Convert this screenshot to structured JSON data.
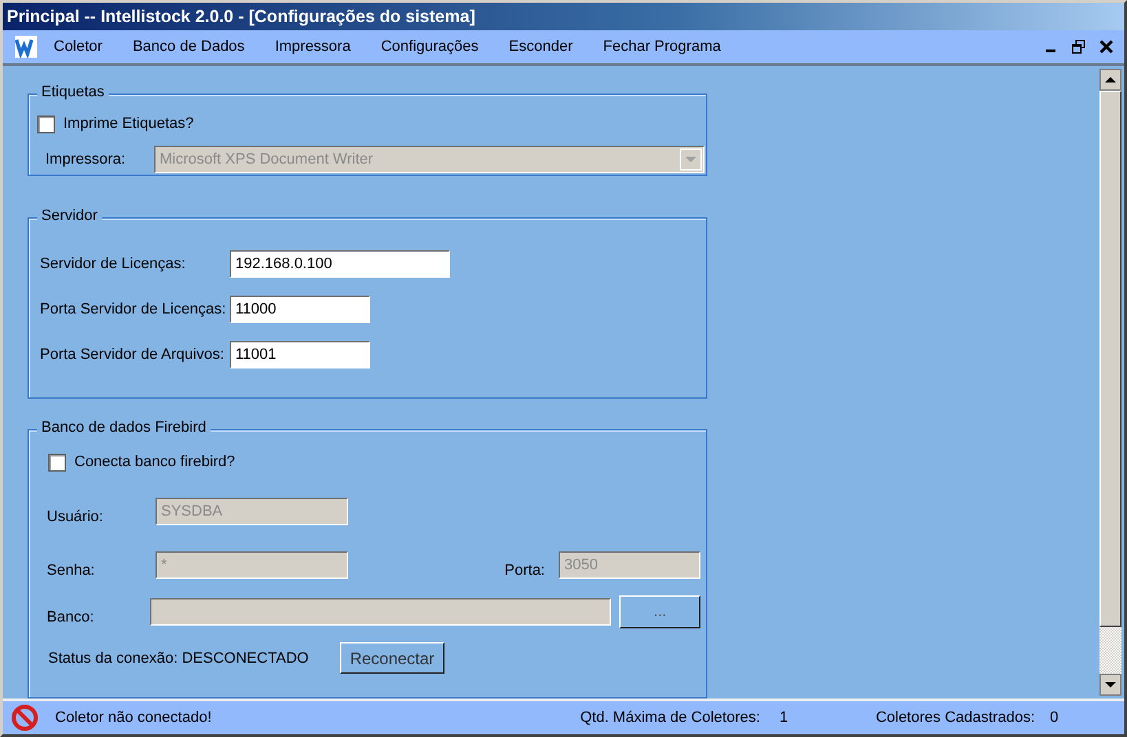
{
  "window": {
    "title": "Principal -- Intellistock 2.0.0 - [Configurações do sistema]"
  },
  "menu": {
    "items": [
      {
        "label": "Coletor"
      },
      {
        "label": "Banco de Dados"
      },
      {
        "label": "Impressora"
      },
      {
        "label": "Configurações"
      },
      {
        "label": "Esconder"
      },
      {
        "label": "Fechar Programa"
      }
    ]
  },
  "etiquetas": {
    "title": "Etiquetas",
    "checkbox": {
      "label": "Imprime Etiquetas?",
      "checked": false
    },
    "printer": {
      "label": "Impressora:",
      "value": "Microsoft XPS Document Writer",
      "disabled": true
    }
  },
  "servidor": {
    "title": "Servidor",
    "fields": [
      {
        "label": "Servidor de Licenças:",
        "value": "192.168.0.100",
        "disabled": false
      },
      {
        "label": "Porta Servidor de Licenças:",
        "value": "11000",
        "disabled": false
      },
      {
        "label": "Porta Servidor de Arquivos:",
        "value": "11001",
        "disabled": false
      }
    ]
  },
  "firebird": {
    "title": "Banco de dados Firebird",
    "checkbox": {
      "label": "Conecta banco firebird?",
      "checked": false
    },
    "user": {
      "label": "Usuário:",
      "value": "SYSDBA",
      "disabled": true
    },
    "password": {
      "label": "Senha:",
      "value": "*",
      "disabled": true
    },
    "port": {
      "label": "Porta:",
      "value": "3050",
      "disabled": true
    },
    "database": {
      "label": "Banco:",
      "disabled": true,
      "browse_button": "..."
    },
    "status": "Status da conexão: DESCONECTADO",
    "reconnect_button": "Reconectar"
  },
  "status_bar": {
    "message": "Coletor não conectado!",
    "max_label": "Qtd. Máxima de Coletores:",
    "max_value": "1",
    "registered_label": "Coletores Cadastrados:",
    "registered_value": "0"
  }
}
